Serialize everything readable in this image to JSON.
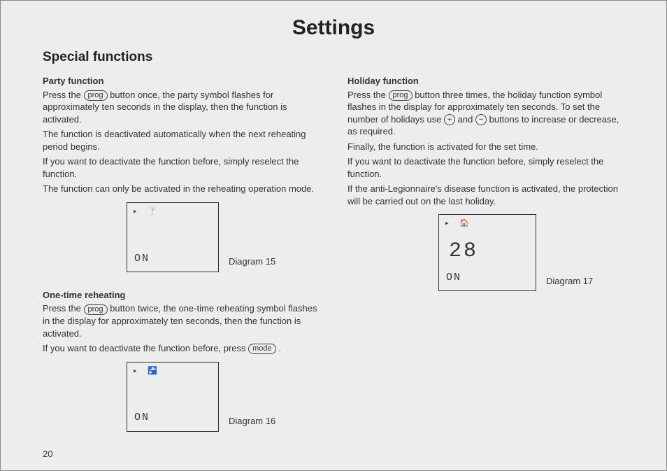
{
  "title": "Settings",
  "pageNumber": "20",
  "subheading": "Special functions",
  "buttons": {
    "prog": "prog",
    "mode": "mode",
    "plus": "+",
    "minus": "−"
  },
  "lcd": {
    "on": "ON",
    "d15_icons": "▸  🍸",
    "d16_icons": "▸  🚰",
    "d17_icons": "▸   🏠",
    "d17_value": "28"
  },
  "left": {
    "party": {
      "head": "Party function",
      "p1a": "Press the ",
      "p1b": " button once, the party symbol flashes for approximately ten seconds in the display, then the function is activated.",
      "p2": "The function is deactivated automatically when the next reheating period begins.",
      "p3": "If you want to deactivate the function before, simply reselect the function.",
      "p4": "The function can only be activated in the reheating operation mode.",
      "diagram": "Diagram 15"
    },
    "onetime": {
      "head": "One-time reheating",
      "p1a": "Press the ",
      "p1b": " button twice, the one-time reheating symbol flashes in the display for approximately ten seconds, then the function is activated.",
      "p2a": "If you want to deactivate the function before, press ",
      "p2b": ".",
      "diagram": "Diagram 16"
    }
  },
  "right": {
    "holiday": {
      "head": "Holiday function",
      "p1a": "Press the ",
      "p1b": " button three times, the holiday function symbol flashes in the display for approximately ten seconds. To set the number of holidays use ",
      "p1c": " and ",
      "p1d": " buttons to increase or decrease, as required.",
      "p2": "Finally, the function is activated for the set time.",
      "p3": "If you want to deactivate the function before, simply reselect the function.",
      "p4": "If the anti-Legionnaire's disease function is activated, the protection will be carried out on the last holiday.",
      "diagram": "Diagram 17"
    }
  }
}
